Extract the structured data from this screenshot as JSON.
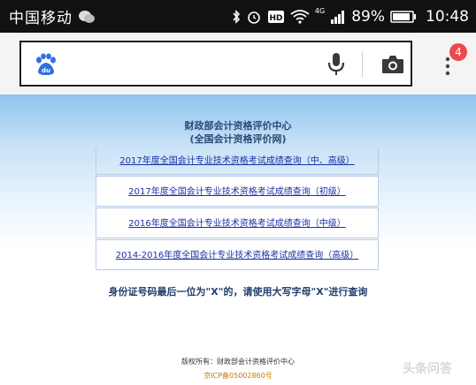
{
  "status_bar": {
    "carrier": "中国移动",
    "network": "4G",
    "battery": "89%",
    "time": "10:48"
  },
  "browser": {
    "address_placeholder": "",
    "badge_count": "4"
  },
  "page": {
    "org_name": "财政部会计资格评价中心",
    "org_subtitle": "(全国会计资格评价网)",
    "links": [
      "2017年度全国会计专业技术资格考试成绩查询（中、高级）",
      "2017年度全国会计专业技术资格考试成绩查询（初级）",
      "2016年度全国会计专业技术资格考试成绩查询（中级）",
      "2014-2016年度全国会计专业技术资格考试成绩查询（高级）"
    ],
    "note": "身份证号码最后一位为\"X\"的，请使用大写字母\"X\"进行查询",
    "footer_copyright": "版权所有：财政部会计资格评价中心",
    "footer_icp": "京ICP备05002860号"
  },
  "watermark": "头条问答"
}
